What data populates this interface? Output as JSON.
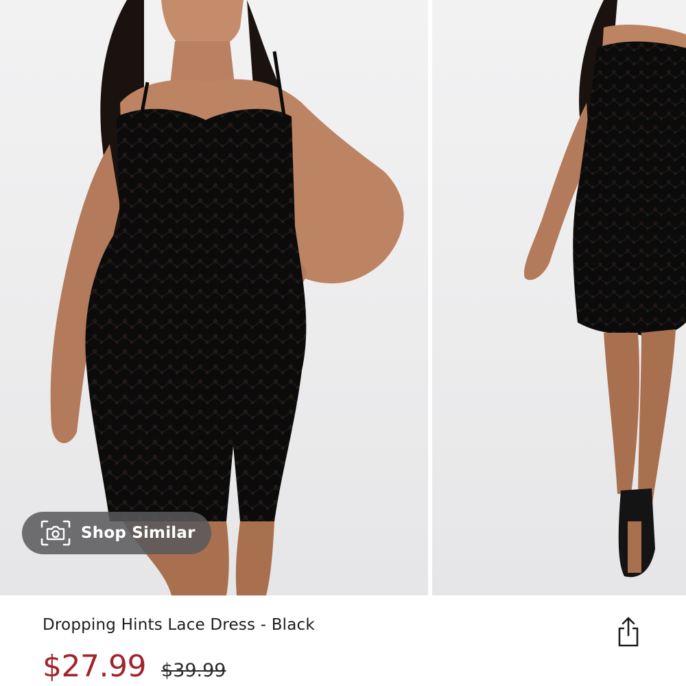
{
  "gallery": {
    "images": [
      {
        "alt": "model-front-hand-on-hip"
      },
      {
        "alt": "model-front-walking"
      }
    ]
  },
  "shop_similar": {
    "label": "Shop Similar",
    "icon": "camera-icon"
  },
  "product": {
    "title": "Dropping Hints Lace Dress - Black",
    "sale_price": "$27.99",
    "original_price": "$39.99"
  },
  "share": {
    "icon": "share-icon"
  },
  "colors": {
    "sale_price": "#a3232c",
    "pill_background": "#58585c",
    "text": "#1c1c1c"
  }
}
